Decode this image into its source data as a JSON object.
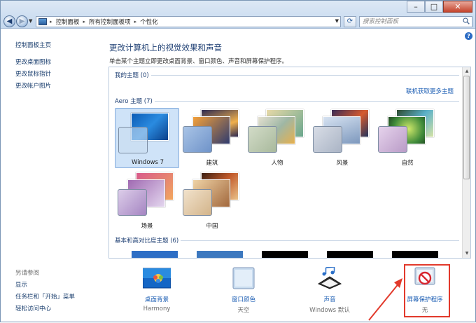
{
  "titlebar": {
    "breadcrumbs": [
      "控制面板",
      "所有控制面板项",
      "个性化"
    ],
    "search_placeholder": "搜索控制面板"
  },
  "sidebar": {
    "home": "控制面板主页",
    "links": [
      "更改桌面图标",
      "更改鼠标指针",
      "更改帐户图片"
    ],
    "see_also_title": "另请参阅",
    "see_also": [
      "显示",
      "任务栏和「开始」菜单",
      "轻松访问中心"
    ]
  },
  "main": {
    "heading": "更改计算机上的视觉效果和声音",
    "subtext": "单击某个主题立即更改桌面背景、窗口颜色、声音和屏幕保护程序。",
    "my_themes": "我的主题 (0)",
    "online_link": "联机获取更多主题",
    "aero_header": "Aero 主题 (7)",
    "aero_themes": [
      {
        "name": "Windows 7",
        "selected": true
      },
      {
        "name": "建筑",
        "selected": false
      },
      {
        "name": "人物",
        "selected": false
      },
      {
        "name": "风景",
        "selected": false
      },
      {
        "name": "自然",
        "selected": false
      },
      {
        "name": "场景",
        "selected": false
      },
      {
        "name": "中国",
        "selected": false
      }
    ],
    "basic_header": "基本和高对比度主题 (6)"
  },
  "bottom": {
    "items": [
      {
        "label": "桌面背景",
        "value": "Harmony",
        "icon": "desktop-background-icon"
      },
      {
        "label": "窗口颜色",
        "value": "天空",
        "icon": "window-color-icon"
      },
      {
        "label": "声音",
        "value": "Windows 默认",
        "icon": "sound-icon"
      },
      {
        "label": "屏幕保护程序",
        "value": "无",
        "icon": "screensaver-icon"
      }
    ]
  },
  "colors": {
    "link": "#1a5cb3",
    "heading": "#1e3f73",
    "highlight": "#e23a2c",
    "selected_tile": "#cfe3f8"
  }
}
